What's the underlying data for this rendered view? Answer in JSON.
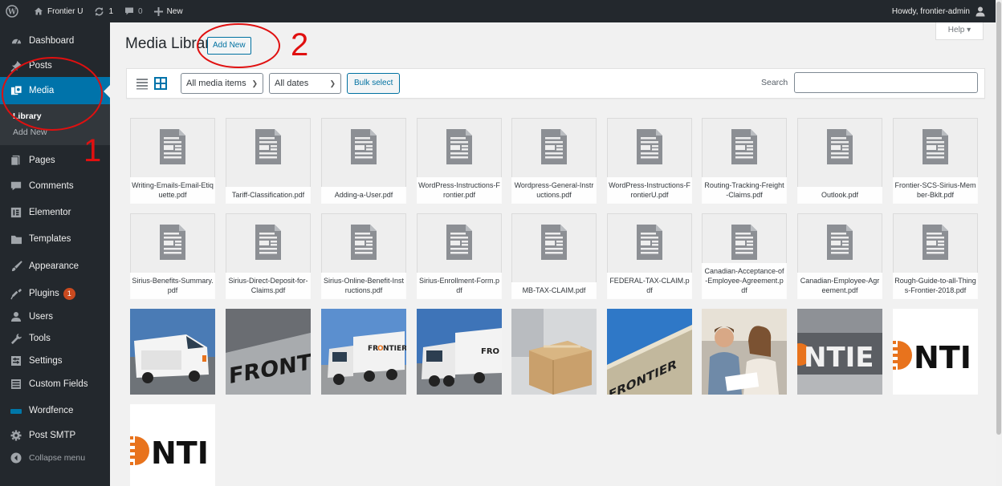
{
  "admin_bar": {
    "site_name": "Frontier U",
    "updates_count": "1",
    "comments_count": "0",
    "new_label": "New",
    "greeting": "Howdy, frontier-admin"
  },
  "sidebar": {
    "items": [
      {
        "label": "Dashboard",
        "icon": "dashboard-icon"
      },
      {
        "label": "Posts",
        "icon": "pin-icon"
      },
      {
        "label": "Media",
        "icon": "media-icon"
      },
      {
        "label": "Pages",
        "icon": "pages-icon"
      },
      {
        "label": "Comments",
        "icon": "comment-icon"
      },
      {
        "label": "Elementor",
        "icon": "elementor-icon"
      },
      {
        "label": "Templates",
        "icon": "folder-icon"
      },
      {
        "label": "Appearance",
        "icon": "brush-icon"
      },
      {
        "label": "Plugins",
        "icon": "plug-icon",
        "badge": "1"
      },
      {
        "label": "Users",
        "icon": "user-icon"
      },
      {
        "label": "Tools",
        "icon": "wrench-icon"
      },
      {
        "label": "Settings",
        "icon": "settings-icon"
      },
      {
        "label": "Custom Fields",
        "icon": "fields-icon"
      },
      {
        "label": "Wordfence",
        "icon": "wordfence-icon"
      },
      {
        "label": "Post SMTP",
        "icon": "gear-icon"
      },
      {
        "label": "Collapse menu",
        "icon": "collapse-icon"
      }
    ],
    "media_submenu": [
      "Library",
      "Add New"
    ]
  },
  "header": {
    "title": "Media Library",
    "add_new": "Add New",
    "help": "Help"
  },
  "toolbar": {
    "type_filter": "All media items",
    "date_filter": "All dates",
    "bulk_select": "Bulk select",
    "search_label": "Search",
    "search_value": ""
  },
  "media": {
    "row1": [
      "Writing-Emails-Email-Etiquette.pdf",
      "Tariff-Classification.pdf",
      "Adding-a-User.pdf",
      "WordPress-Instructions-Frontier.pdf",
      "Wordpress-General-Instructions.pdf",
      "WordPress-Instructions-FrontierU.pdf",
      "Routing-Tracking-Freight-Claims.pdf",
      "Outlook.pdf",
      "Frontier-SCS-Sirius-Member-Bklt.pdf"
    ],
    "row2": [
      "Sirius-Benefits-Summary.pdf",
      "Sirius-Direct-Deposit-for-Claims.pdf",
      "Sirius-Online-Benefit-Instructions.pdf",
      "Sirius-Enrollment-Form.pdf",
      "MB-TAX-CLAIM.pdf",
      "FEDERAL-TAX-CLAIM.pdf",
      "Canadian-Acceptance-of-Employee-Agreement.pdf",
      "Canadian-Employee-Agreement.pdf",
      "Rough-Guide-to-all-Things-Frontier-2018.pdf"
    ],
    "photo_text": {
      "frontier": "FRONTIER",
      "ntie": "NTIE",
      "nti": "NTI",
      "frntier": "FRONTIER"
    }
  },
  "annotations": {
    "number_1": "1",
    "number_2": "2",
    "color": "#e01010"
  }
}
